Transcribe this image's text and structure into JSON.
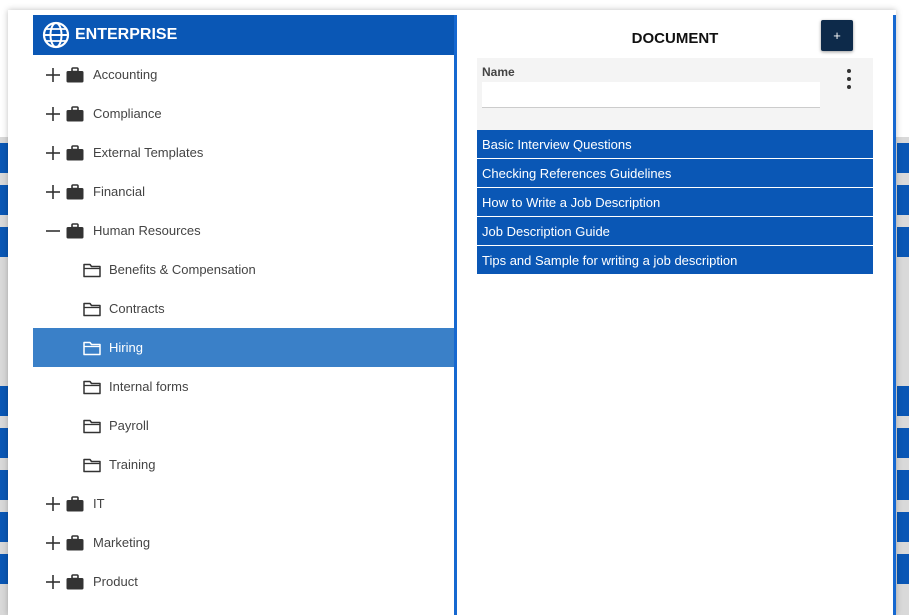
{
  "tree": {
    "root_label": "ENTERPRISE",
    "items": [
      {
        "label": "Accounting",
        "level": 0,
        "expanded": false,
        "icon": "briefcase-icon"
      },
      {
        "label": "Compliance",
        "level": 0,
        "expanded": false,
        "icon": "briefcase-icon"
      },
      {
        "label": "External Templates",
        "level": 0,
        "expanded": false,
        "icon": "briefcase-icon"
      },
      {
        "label": "Financial",
        "level": 0,
        "expanded": false,
        "icon": "briefcase-icon"
      },
      {
        "label": "Human Resources",
        "level": 0,
        "expanded": true,
        "icon": "briefcase-icon"
      },
      {
        "label": "Benefits & Compensation",
        "level": 1,
        "icon": "folder-icon"
      },
      {
        "label": "Contracts",
        "level": 1,
        "icon": "folder-icon"
      },
      {
        "label": "Hiring",
        "level": 1,
        "icon": "folder-icon",
        "selected": true
      },
      {
        "label": "Internal forms",
        "level": 1,
        "icon": "folder-icon"
      },
      {
        "label": "Payroll",
        "level": 1,
        "icon": "folder-icon"
      },
      {
        "label": "Training",
        "level": 1,
        "icon": "folder-icon"
      },
      {
        "label": "IT",
        "level": 0,
        "expanded": false,
        "icon": "briefcase-icon"
      },
      {
        "label": "Marketing",
        "level": 0,
        "expanded": false,
        "icon": "briefcase-icon"
      },
      {
        "label": "Product",
        "level": 0,
        "expanded": false,
        "icon": "briefcase-icon"
      }
    ]
  },
  "document": {
    "title": "DOCUMENT",
    "add_label": "+",
    "filter": {
      "label": "Name",
      "value": "",
      "placeholder": ""
    },
    "items": [
      "Basic Interview Questions",
      "Checking References Guidelines",
      "How to Write a Job Description",
      "Job Description Guide",
      "Tips and Sample for writing a job description"
    ]
  },
  "colors": {
    "primary": "#0a57b5",
    "selected": "#3a80c8",
    "add_button": "#0d2a4a"
  }
}
